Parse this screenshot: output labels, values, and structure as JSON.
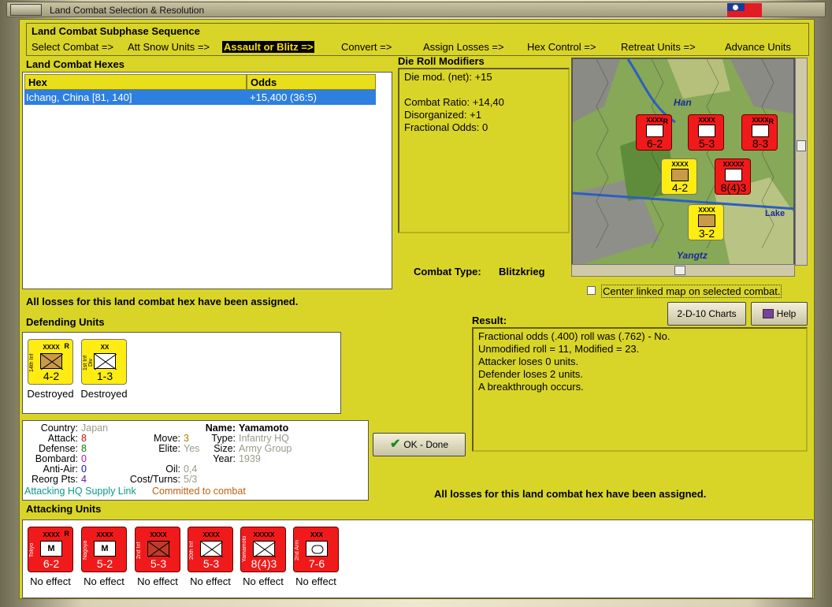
{
  "window": {
    "title": "Land Combat Selection & Resolution"
  },
  "subphase": {
    "title": "Land Combat Subphase Sequence",
    "steps": [
      "Select Combat =>",
      "Att Snow Units =>",
      "Assault or Blitz =>",
      "Convert =>",
      "Assign Losses =>",
      "Hex Control =>",
      "Retreat Units =>",
      "Advance Units"
    ],
    "selected_index": 2
  },
  "hexes": {
    "title": "Land Combat Hexes",
    "col_hex": "Hex",
    "col_odds": "Odds",
    "rows": [
      {
        "hex": "Ichang, China [81, 140]",
        "odds": "+15,400 (36:5)"
      }
    ]
  },
  "die": {
    "title": "Die Roll Modifiers",
    "lines": [
      "Die mod. (net): +15",
      "",
      "Combat Ratio: +14,40",
      "Disorganized: +1",
      "Fractional Odds: 0"
    ]
  },
  "combat_type": {
    "label": "Combat Type:",
    "value": "Blitzkrieg"
  },
  "center_map": {
    "label": "Center linked map on selected combat.",
    "checked": false
  },
  "losses_msg": "All losses for this land combat hex have been assigned.",
  "losses_msg2": "All losses for this land combat hex have been assigned.",
  "buttons": {
    "charts": "2-D-10 Charts",
    "help": "Help",
    "ok": "OK - Done"
  },
  "defending": {
    "title": "Defending Units",
    "units": [
      {
        "name": "14th Inf",
        "size": "XXXX",
        "str": "4-2",
        "r": "R",
        "status": "Destroyed"
      },
      {
        "name": "1st Inf Div",
        "size": "XX",
        "str": "1-3",
        "r": "",
        "status": "Destroyed"
      }
    ]
  },
  "result": {
    "title": "Result:",
    "lines": [
      "Fractional odds (.400) roll was (.762)  - No.",
      "Unmodified roll = 11, Modified = 23.",
      "Attacker loses 0 units.",
      "Defender loses 2 units.",
      "A breakthrough occurs."
    ]
  },
  "info": {
    "country_l": "Country:",
    "country": "Japan",
    "attack_l": "Attack:",
    "attack": "8",
    "defense_l": "Defense:",
    "defense": "8",
    "bombard_l": "Bombard:",
    "bombard": "0",
    "antiair_l": "Anti-Air:",
    "antiair": "0",
    "reorg_l": "Reorg Pts:",
    "reorg": "4",
    "move_l": "Move:",
    "move": "3",
    "elite_l": "Elite:",
    "elite": "Yes",
    "oil_l": "Oil:",
    "oil": "0,4",
    "cost_l": "Cost/Turns:",
    "cost": "5/3",
    "name_l": "Name:",
    "name": "Yamamoto",
    "type_l": "Type:",
    "type": "Infantry HQ",
    "size_l": "Size:",
    "size": "Army Group",
    "year_l": "Year:",
    "year": "1939",
    "supply": "Attacking HQ Supply Link",
    "committed": "Committed to combat"
  },
  "attacking": {
    "title": "Attacking Units",
    "units": [
      {
        "name": "Tokyo",
        "size": "XXXX",
        "str": "6-2",
        "r": "R",
        "icon": "M",
        "status": "No effect"
      },
      {
        "name": "Nagoya",
        "size": "XXXX",
        "str": "5-2",
        "r": "",
        "icon": "M",
        "status": "No effect"
      },
      {
        "name": "2nd Inf",
        "size": "XXXX",
        "str": "5-3",
        "r": "",
        "icon": "X",
        "status": "No effect"
      },
      {
        "name": "20th Inf",
        "size": "XXXX",
        "str": "5-3",
        "r": "",
        "icon": "X",
        "status": "No effect"
      },
      {
        "name": "Yamamoto",
        "size": "XXXXX",
        "str": "8(4)3",
        "r": "",
        "icon": "X",
        "status": "No effect"
      },
      {
        "name": "2nd Arm",
        "size": "XXX",
        "str": "7-6",
        "r": "",
        "icon": "O",
        "status": "No effect"
      }
    ]
  },
  "map": {
    "labels": [
      "Han",
      "Lake",
      "Yangtz"
    ],
    "units": [
      {
        "size": "XXXX",
        "str": "6-2",
        "icon": "M",
        "r": "R"
      },
      {
        "size": "XXXX",
        "str": "5-3",
        "icon": "X",
        "r": ""
      },
      {
        "size": "XXXX",
        "str": "8-3",
        "icon": "X",
        "r": "R"
      },
      {
        "size": "XXXX",
        "str": "4-2",
        "icon": "X",
        "r": ""
      },
      {
        "size": "XXXXX",
        "str": "8(4)3",
        "icon": "X",
        "r": ""
      },
      {
        "size": "XXXX",
        "str": "3-2",
        "icon": "X",
        "r": ""
      }
    ]
  },
  "colors": {
    "panel": "#d9d528",
    "red_unit": "#f11a1a",
    "yellow_unit": "#ffec12",
    "selection": "#2d7fe0"
  }
}
